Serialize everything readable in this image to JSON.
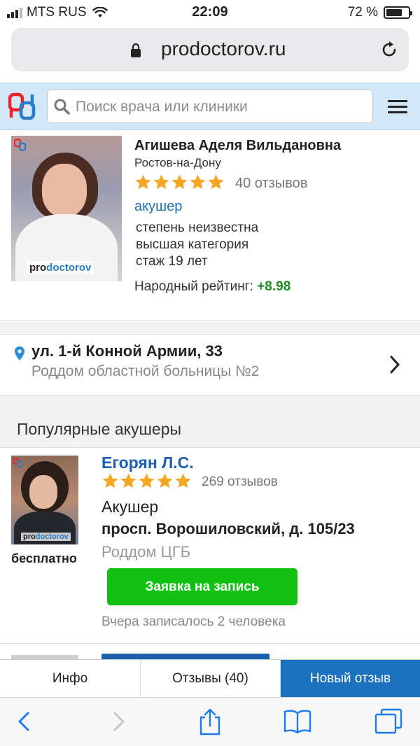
{
  "status_bar": {
    "carrier": "MTS RUS",
    "time": "22:09",
    "battery": "72 %",
    "battery_level": 0.72
  },
  "browser": {
    "url": "prodoctorov.ru"
  },
  "site_header": {
    "search_placeholder": "Поиск врача или клиники"
  },
  "doctor": {
    "name": "Агишева Аделя Вильдановна",
    "city": "Ростов-на-Дону",
    "stars": 5,
    "reviews": "40 отзывов",
    "specialty": "акушер",
    "degree": "степень неизвестна",
    "category": "высшая категория",
    "experience": "стаж 19 лет",
    "rating_label": "Народный рейтинг:",
    "rating_value": "+8.98",
    "photo_watermark_pro": "pro",
    "photo_watermark_doctorov": "doctorov"
  },
  "address": {
    "street": "ул. 1-й Конной Армии, 33",
    "clinic": "Роддом областной больницы №2"
  },
  "popular": {
    "title": "Популярные акушеры",
    "doctor": {
      "name": "Егорян Л.С.",
      "stars": 5,
      "reviews": "269 отзывов",
      "specialty": "Акушер",
      "street": "просп. Ворошиловский, д. 105/23",
      "clinic": "Роддом ЦГБ",
      "price": "бесплатно",
      "book_button": "Заявка на запись",
      "note": "Вчера записалось 2 человека"
    }
  },
  "bottom_tabs": [
    {
      "label": "Инфо"
    },
    {
      "label": "Отзывы (40)"
    },
    {
      "label": "Новый отзыв"
    }
  ],
  "colors": {
    "accent": "#1d72bd",
    "link": "#1d5fae",
    "rating_positive": "#1f8a1f",
    "book_button": "#12c012",
    "star": "#f5a623"
  },
  "icons": [
    "signal-icon",
    "wifi-icon",
    "battery-icon",
    "lock-icon",
    "reload-icon",
    "logo-icon",
    "search-icon",
    "menu-icon",
    "star-icon",
    "location-pin-icon",
    "chevron-right-icon",
    "back-icon",
    "forward-icon",
    "share-icon",
    "bookmarks-icon",
    "tabs-icon"
  ]
}
